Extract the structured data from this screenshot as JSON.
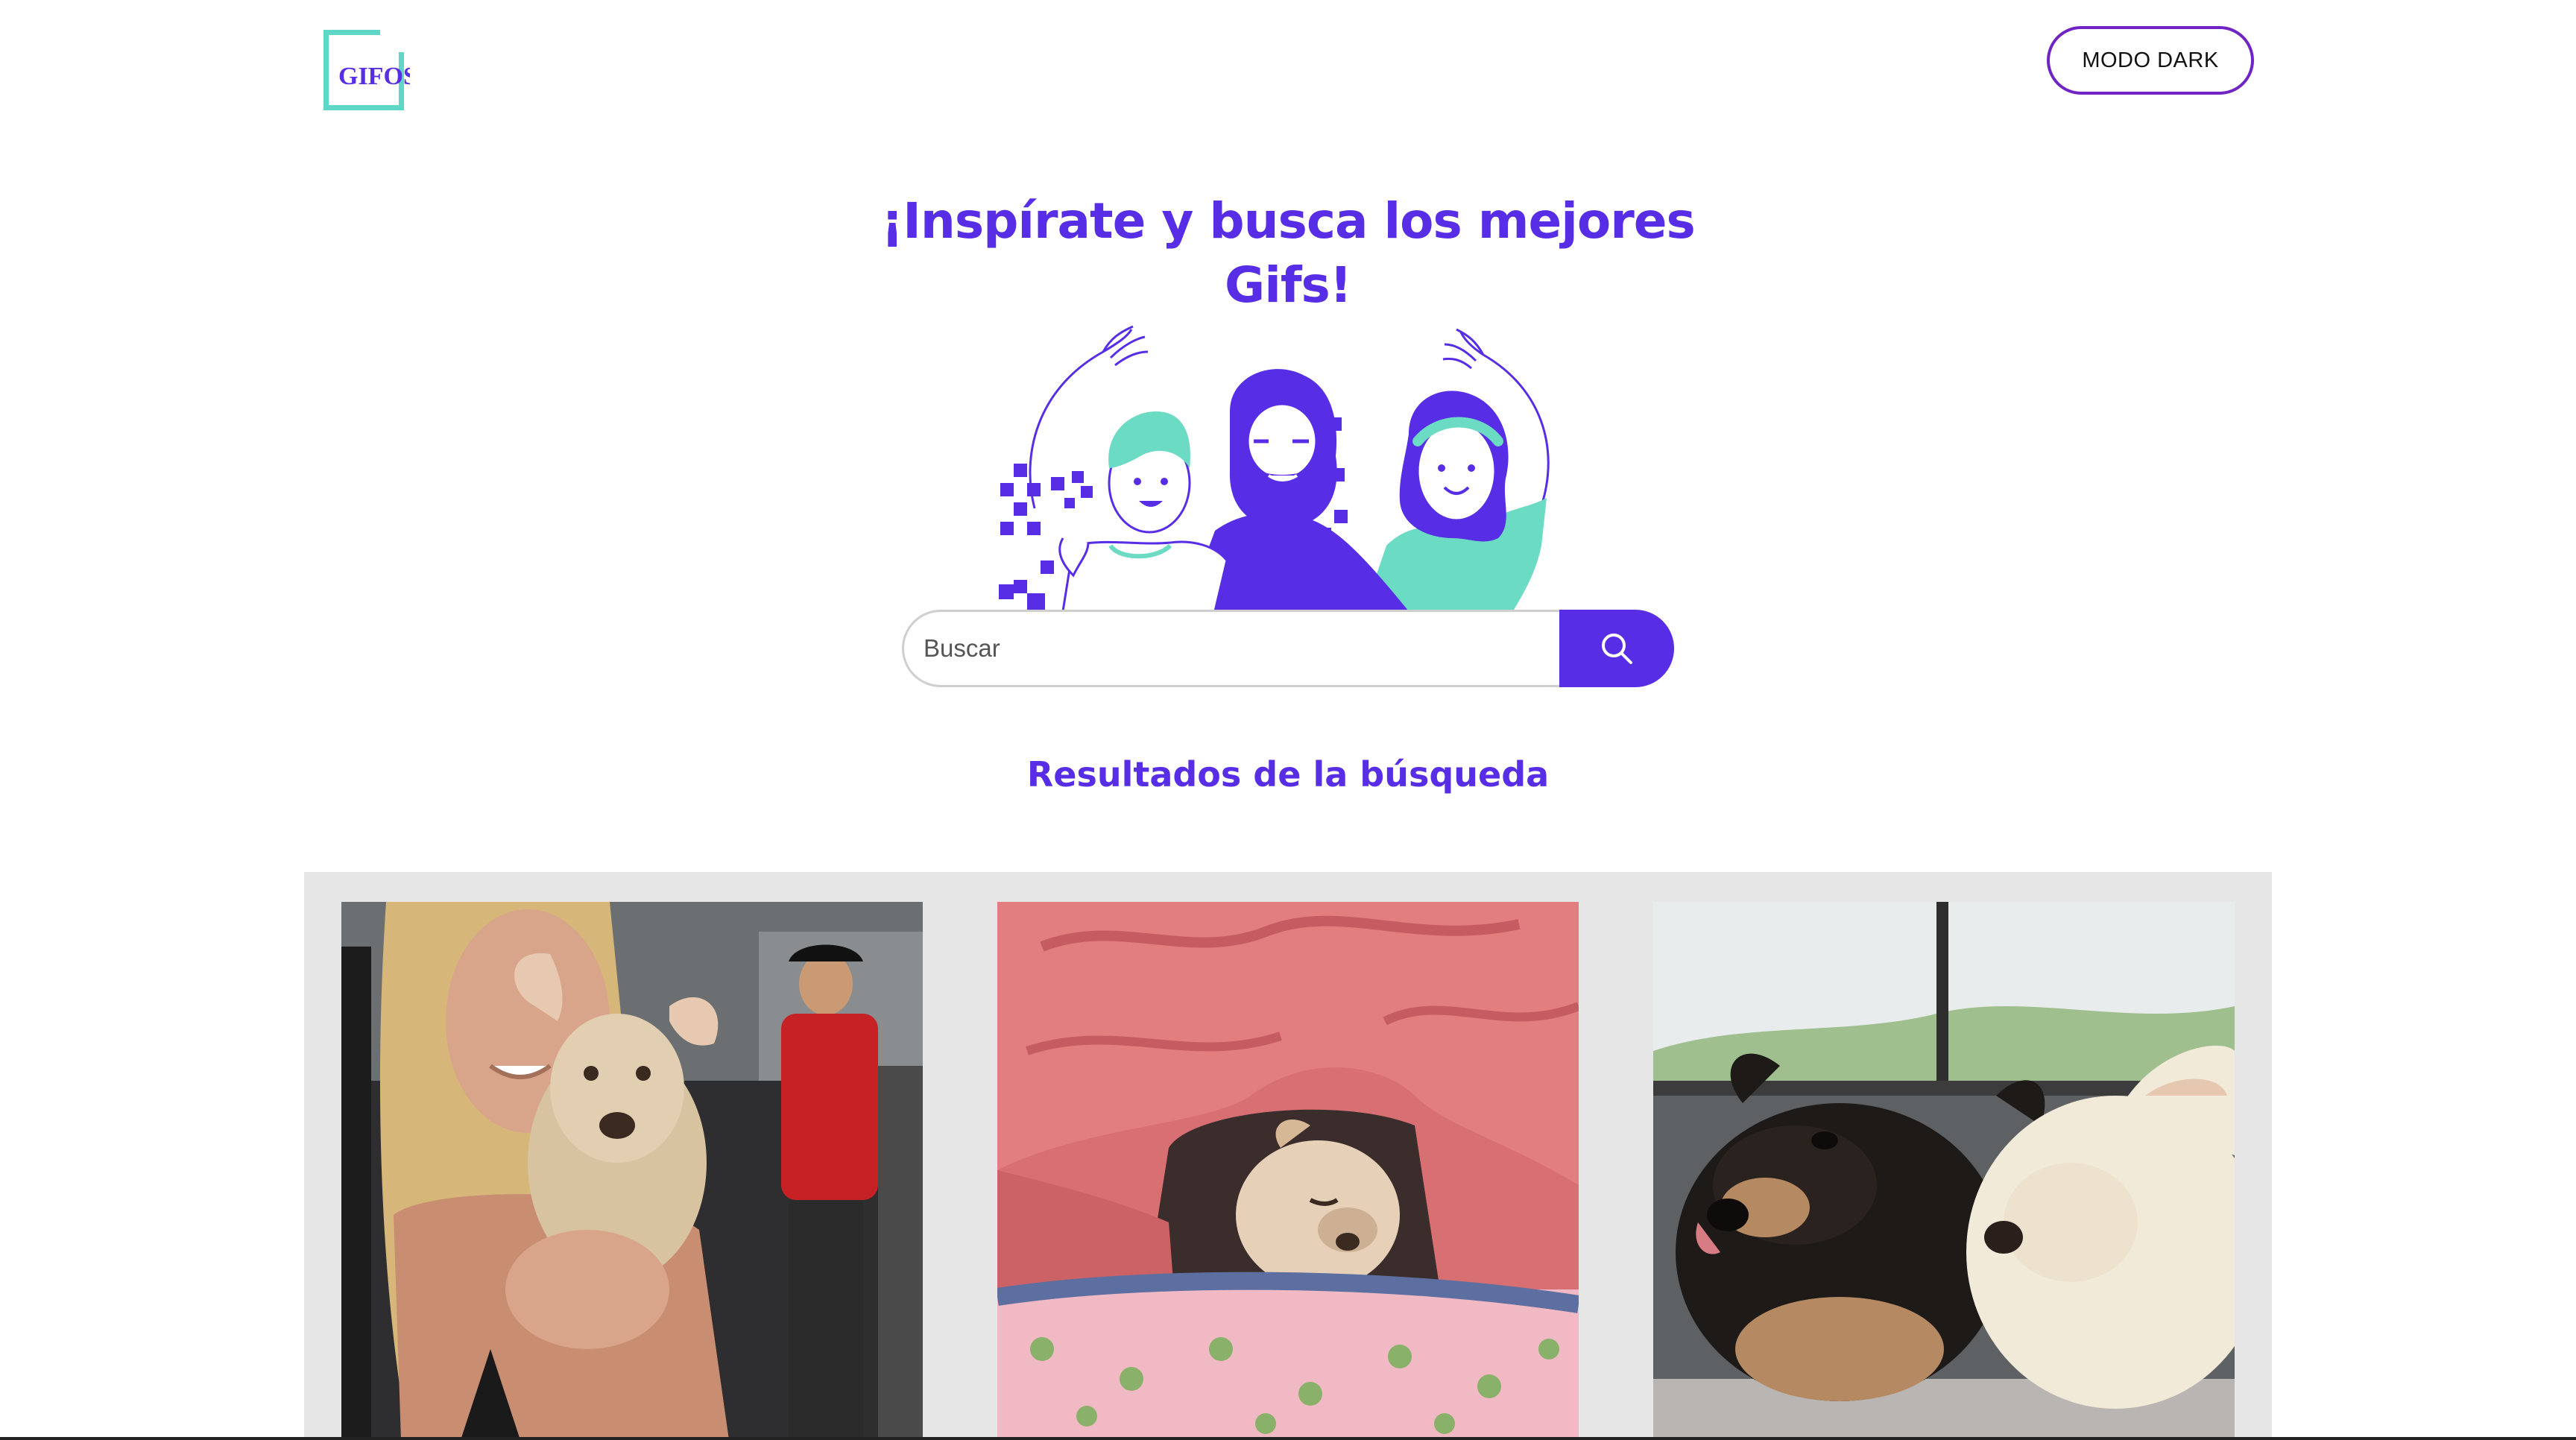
{
  "header": {
    "logo_text": "GIFOS",
    "mode_button_label": "MODO DARK"
  },
  "hero": {
    "title_line1": "¡Inspírate y busca los mejores",
    "title_line2": "Gifs!"
  },
  "search": {
    "placeholder": "Buscar",
    "value": "",
    "button_icon": "search-icon"
  },
  "results": {
    "title": "Resultados de la búsqueda",
    "items": [
      {
        "icon": "gif-image",
        "subject": "woman holding chihuahua"
      },
      {
        "icon": "gif-image",
        "subject": "chihuahua under pink blanket"
      },
      {
        "icon": "gif-image",
        "subject": "two chihuahuas"
      }
    ]
  },
  "colors": {
    "brand_purple": "#572EE5",
    "button_border": "#7024C4",
    "brand_teal": "#5ED7C6",
    "results_background": "#E6E6E6"
  }
}
